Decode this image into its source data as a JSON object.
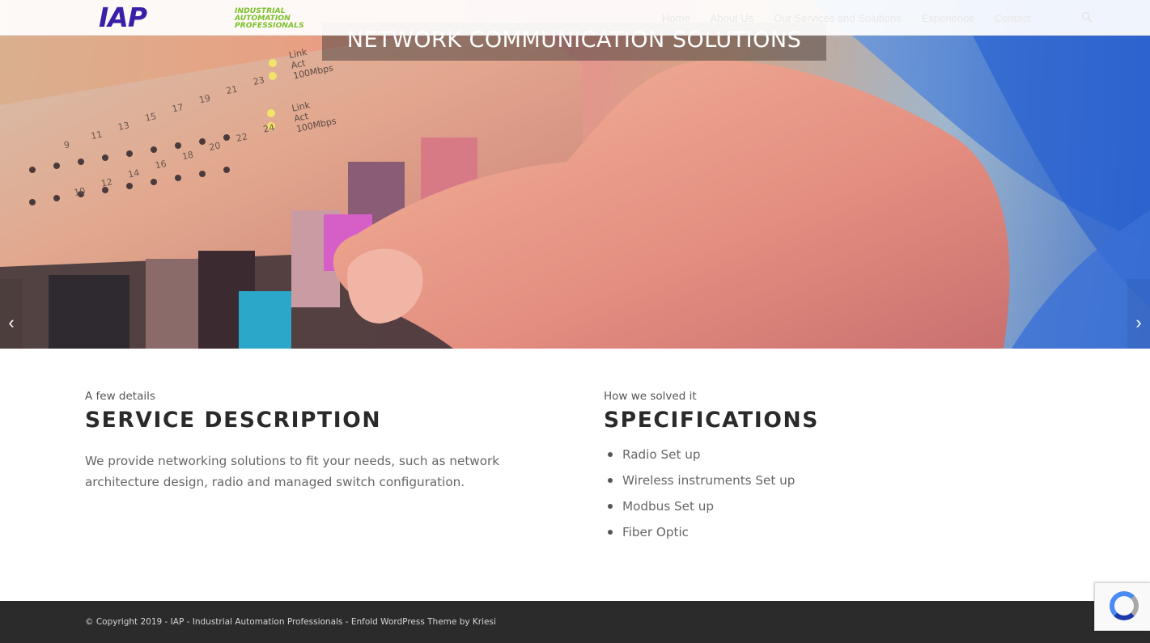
{
  "header": {
    "logo": {
      "mark": "IAP",
      "line1": "Industrial",
      "line2": "Automation",
      "line3": "Professionals"
    },
    "nav": [
      {
        "label": "Home"
      },
      {
        "label": "About Us"
      },
      {
        "label": "Our Services and Solutions"
      },
      {
        "label": "Experience"
      },
      {
        "label": "Contact"
      }
    ],
    "search_icon": "search-icon"
  },
  "hero": {
    "title": "Network Communication Solutions",
    "panel_labels": [
      "Link",
      "Act",
      "100Mbps",
      "Link",
      "Act",
      "100Mbps"
    ],
    "port_numbers": [
      "23",
      "21",
      "19",
      "17",
      "15",
      "13",
      "11",
      "9",
      "24",
      "22",
      "20",
      "18",
      "16",
      "14",
      "12",
      "10"
    ],
    "prev_arrow": "‹",
    "next_arrow": "›"
  },
  "service": {
    "kicker": "A few details",
    "heading": "Service Description",
    "body": "We provide networking solutions to fit your needs, such as network architecture design, radio and managed switch configuration."
  },
  "specs": {
    "kicker": "How we solved it",
    "heading": "Specifications",
    "items": [
      "Radio Set up",
      "Wireless instruments Set up",
      "Modbus Set up",
      "Fiber Optic"
    ]
  },
  "footer": {
    "copyright": "© Copyright 2019 - IAP - Industrial Automation Professionals - Enfold WordPress Theme by Kriesi"
  },
  "colors": {
    "logo_purple": "#3b1fa6",
    "logo_green": "#7ac12a",
    "footer_bg": "#2b2b2b"
  }
}
